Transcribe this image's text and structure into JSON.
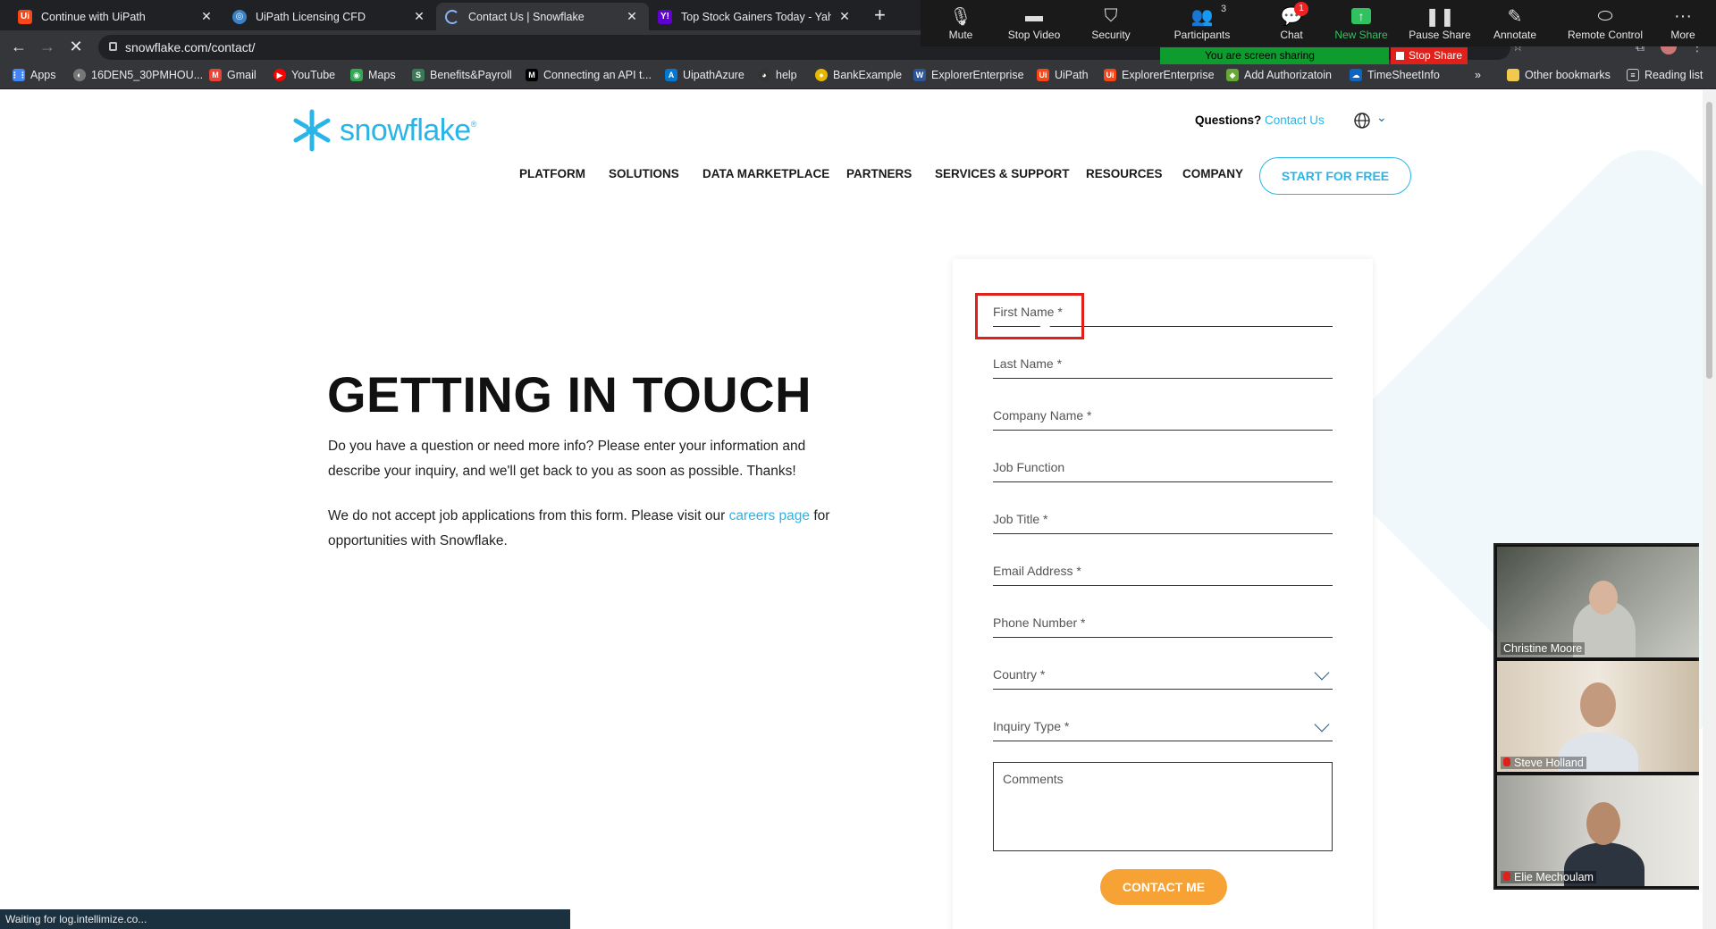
{
  "browser": {
    "tabs": [
      {
        "title": "Continue with UiPath",
        "favicon": "uipath-icon",
        "active": false
      },
      {
        "title": "UiPath Licensing CFD",
        "favicon": "uipath-circle-icon",
        "active": false
      },
      {
        "title": "Contact Us | Snowflake",
        "favicon": "loading-icon",
        "active": true
      },
      {
        "title": "Top Stock Gainers Today - Yahoo",
        "favicon": "yahoo-icon",
        "active": false
      }
    ],
    "url": "snowflake.com/contact/",
    "bookmarks": [
      "Apps",
      "16DEN5_30PMHOU...",
      "Gmail",
      "YouTube",
      "Maps",
      "Benefits&Payroll",
      "Connecting an API t...",
      "UipathAzure",
      "help",
      "BankExample",
      "ExplorerEnterprise",
      "UiPath",
      "ExplorerEnterprise",
      "Add Authorizatoin",
      "TimeSheetInfo"
    ],
    "overflow": "»",
    "other_bookmarks": "Other bookmarks",
    "reading_list": "Reading list",
    "status": "Waiting for log.intellimize.co..."
  },
  "zoom": {
    "buttons": [
      {
        "label": "Mute",
        "icon": "mic-icon"
      },
      {
        "label": "Stop Video",
        "icon": "camera-icon"
      },
      {
        "label": "Security",
        "icon": "shield-icon"
      },
      {
        "label": "Participants",
        "icon": "participants-icon",
        "count": "3"
      },
      {
        "label": "Chat",
        "icon": "chat-icon",
        "badge": "1"
      },
      {
        "label": "New Share",
        "icon": "share-icon"
      },
      {
        "label": "Pause Share",
        "icon": "pause-icon"
      },
      {
        "label": "Annotate",
        "icon": "pen-icon"
      },
      {
        "label": "Remote Control",
        "icon": "mouse-icon"
      },
      {
        "label": "More",
        "icon": "more-icon"
      }
    ],
    "sharing_label": "You are screen sharing",
    "stop_share": "Stop Share",
    "participants": [
      "Christine Moore",
      "Steve Holland",
      "Elie Mechoulam"
    ]
  },
  "site": {
    "logo_text": "snowflake",
    "questions": "Questions?",
    "contact_link": "Contact Us",
    "nav": [
      "PLATFORM",
      "SOLUTIONS",
      "DATA MARKETPLACE",
      "PARTNERS",
      "SERVICES & SUPPORT",
      "RESOURCES",
      "COMPANY"
    ],
    "cta": "START FOR FREE",
    "heading": "GETTING IN TOUCH",
    "intro": "Do you have a question or need more info? Please enter your information and describe your inquiry, and we'll get back to you as soon as possible. Thanks!",
    "careers_pre": "We do not accept job applications from this form. Please visit our ",
    "careers_link": "careers page",
    "careers_post": " for opportunities with Snowflake.",
    "brand_color": "#29b5e8"
  },
  "form": {
    "fields": [
      {
        "placeholder": "First Name *"
      },
      {
        "placeholder": "Last Name *"
      },
      {
        "placeholder": "Company Name *"
      },
      {
        "placeholder": "Job Function"
      },
      {
        "placeholder": "Job Title *"
      },
      {
        "placeholder": "Email Address *"
      },
      {
        "placeholder": "Phone Number *"
      },
      {
        "placeholder": "Country *"
      },
      {
        "placeholder": "Inquiry Type *"
      }
    ],
    "comments_placeholder": "Comments",
    "submit": "CONTACT ME"
  }
}
